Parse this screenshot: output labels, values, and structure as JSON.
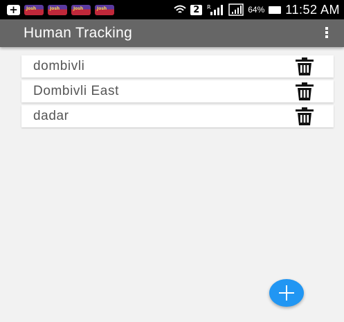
{
  "status_bar": {
    "battery_percent": "64%",
    "time": "11:52 AM",
    "sim_label": "2",
    "signal_label": "R"
  },
  "app_bar": {
    "title": "Human Tracking"
  },
  "locations": [
    {
      "name": "dombivli"
    },
    {
      "name": "Dombivli East"
    },
    {
      "name": "dadar"
    }
  ],
  "colors": {
    "app_bar": "#666666",
    "background": "#f2f2f2",
    "fab": "#2196f3"
  },
  "icons": {
    "delete": "trash-icon",
    "fab": "plus-icon",
    "overflow": "more-vert-icon"
  }
}
